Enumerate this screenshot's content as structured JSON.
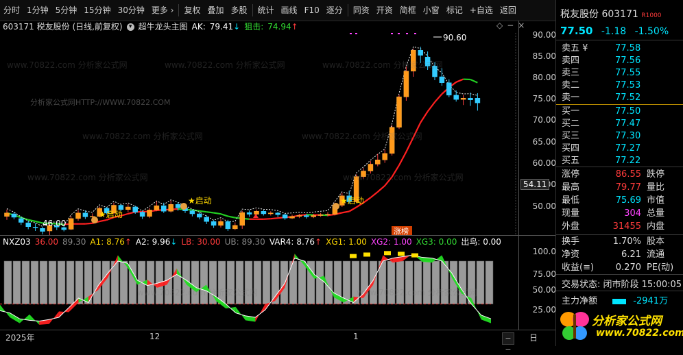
{
  "toolbar": {
    "items": [
      "分时",
      "1分钟",
      "5分钟",
      "15分钟",
      "30分钟",
      "更多 ›",
      "复权",
      "叠加",
      "多股",
      "统计",
      "画线",
      "F10",
      "逐分",
      "同资",
      "开资",
      "简框",
      "小窗",
      "标记",
      "+自选",
      "返回"
    ]
  },
  "main_header": {
    "code_name": "603171 税友股份 (日线,前复权)",
    "indicator": "超牛龙头主图",
    "ak_label": "AK:",
    "ak_value": "79.41",
    "ak_arrow": "↓",
    "snipe_label": "狙击:",
    "snipe_value": "74.94",
    "snipe_arrow": "↑"
  },
  "main_axis": {
    "labels": [
      "90.00",
      "85.00",
      "80.00",
      "75.00",
      "70.00",
      "65.00",
      "60.00",
      "55.00",
      "50.00"
    ],
    "crosshair_value": "54.11"
  },
  "annotations": {
    "high": "90.60",
    "low": "46.00",
    "start_label": "★启动",
    "limit_up": "涨榜"
  },
  "sub_header": {
    "name": "NXZ03",
    "v1": "36.00",
    "v2": "89.30",
    "a1_label": "A1:",
    "a1": "8.76",
    "a1_arrow": "↑",
    "a2_label": "A2:",
    "a2": "9.96",
    "a2_arrow": "↓",
    "lb_label": "LB:",
    "lb": "30.00",
    "ub_label": "UB:",
    "ub": "89.30",
    "var4_label": "VAR4:",
    "var4": "8.76",
    "var4_arrow": "↑",
    "xg1_label": "XG1:",
    "xg1": "1.00",
    "xg2_label": "XG2:",
    "xg2": "1.00",
    "xg3_label": "XG3:",
    "xg3": "0.00",
    "out_label": "出鸟:",
    "out": "0.00"
  },
  "sub_axis": {
    "labels": [
      "100.0",
      "75.00",
      "50.00",
      "25.00"
    ]
  },
  "time_axis": {
    "labels": [
      "2025年",
      "12",
      "1"
    ],
    "right_label": "日"
  },
  "watermark": {
    "text": "www.70822.com 分析家公式网",
    "center_text": "分析家公式网HTTP://WWW.70822.COM"
  },
  "quote": {
    "name": "税友股份",
    "code": "603171",
    "tag": "R1000",
    "price": "77.50",
    "change": "-1.18",
    "change_pct": "-1.50%",
    "asks": [
      {
        "label": "卖五 ¥",
        "price": "77.58"
      },
      {
        "label": "卖四",
        "price": "77.56"
      },
      {
        "label": "卖三",
        "price": "77.55"
      },
      {
        "label": "卖二",
        "price": "77.53"
      },
      {
        "label": "卖一",
        "price": "77.52"
      }
    ],
    "bids": [
      {
        "label": "买一",
        "price": "77.50"
      },
      {
        "label": "买二",
        "price": "77.47"
      },
      {
        "label": "买三",
        "price": "77.30"
      },
      {
        "label": "买四",
        "price": "77.27"
      },
      {
        "label": "买五",
        "price": "77.22"
      }
    ],
    "stats": [
      {
        "label": "涨停",
        "value": "86.55",
        "rlabel": "跌停"
      },
      {
        "label": "最高",
        "value": "79.77",
        "rlabel": "量比"
      },
      {
        "label": "最低",
        "value": "75.69",
        "rlabel": "市值"
      },
      {
        "label": "现量",
        "value": "304",
        "rlabel": "总量"
      },
      {
        "label": "外盘",
        "value": "31455",
        "rlabel": "内盘"
      }
    ],
    "stats2": [
      {
        "label": "换手",
        "value": "1.70%",
        "rlabel": "股本"
      },
      {
        "label": "净资",
        "value": "6.21",
        "rlabel": "流通"
      },
      {
        "label": "收益(≡)",
        "value": "0.270",
        "rlabel": "PE(动)"
      }
    ],
    "trade_status": "交易状态: 闭市阶段 15:00:05",
    "main_flow_label": "主力净额",
    "main_flow_value": "-2941万"
  },
  "logo": {
    "text": "分析家公式网",
    "url": "www.70822.com"
  },
  "chart_data": {
    "type": "candlestick",
    "y_range": [
      44,
      94
    ],
    "candles": [
      {
        "o": 51.0,
        "c": 51.8,
        "h": 52.6,
        "l": 50.2
      },
      {
        "o": 51.6,
        "c": 50.8,
        "h": 52.0,
        "l": 50.3
      },
      {
        "o": 50.5,
        "c": 49.6,
        "h": 51.0,
        "l": 49.0
      },
      {
        "o": 49.5,
        "c": 48.6,
        "h": 50.0,
        "l": 48.0
      },
      {
        "o": 48.5,
        "c": 48.4,
        "h": 49.4,
        "l": 47.6
      },
      {
        "o": 48.2,
        "c": 47.5,
        "h": 48.6,
        "l": 46.8
      },
      {
        "o": 47.6,
        "c": 48.9,
        "h": 49.3,
        "l": 46.0
      },
      {
        "o": 48.9,
        "c": 48.5,
        "h": 49.6,
        "l": 47.8
      },
      {
        "o": 48.4,
        "c": 47.9,
        "h": 48.7,
        "l": 47.5
      },
      {
        "o": 48.0,
        "c": 50.5,
        "h": 51.1,
        "l": 47.8
      },
      {
        "o": 50.5,
        "c": 51.8,
        "h": 52.5,
        "l": 50.0
      },
      {
        "o": 51.8,
        "c": 50.9,
        "h": 52.4,
        "l": 50.4
      },
      {
        "o": 50.9,
        "c": 51.0,
        "h": 51.7,
        "l": 50.2
      },
      {
        "o": 51.0,
        "c": 52.9,
        "h": 53.3,
        "l": 50.8
      },
      {
        "o": 52.9,
        "c": 51.8,
        "h": 53.2,
        "l": 51.5
      },
      {
        "o": 51.8,
        "c": 53.6,
        "h": 54.2,
        "l": 51.5
      },
      {
        "o": 53.6,
        "c": 52.6,
        "h": 53.8,
        "l": 52.2
      },
      {
        "o": 52.6,
        "c": 53.2,
        "h": 53.9,
        "l": 52.0
      },
      {
        "o": 53.2,
        "c": 52.0,
        "h": 53.5,
        "l": 51.6
      },
      {
        "o": 52.0,
        "c": 51.0,
        "h": 52.3,
        "l": 50.4
      },
      {
        "o": 51.0,
        "c": 52.5,
        "h": 53.0,
        "l": 50.6
      },
      {
        "o": 52.5,
        "c": 53.5,
        "h": 54.5,
        "l": 52.2
      },
      {
        "o": 53.5,
        "c": 52.2,
        "h": 54.2,
        "l": 51.8
      },
      {
        "o": 52.2,
        "c": 53.8,
        "h": 54.7,
        "l": 51.9
      },
      {
        "o": 53.8,
        "c": 53.0,
        "h": 54.3,
        "l": 52.3
      },
      {
        "o": 53.0,
        "c": 52.3,
        "h": 53.5,
        "l": 51.8
      },
      {
        "o": 52.3,
        "c": 51.6,
        "h": 52.6,
        "l": 51.0
      },
      {
        "o": 51.6,
        "c": 50.8,
        "h": 52.0,
        "l": 50.3
      },
      {
        "o": 50.8,
        "c": 49.8,
        "h": 51.2,
        "l": 49.2
      },
      {
        "o": 49.8,
        "c": 48.9,
        "h": 50.1,
        "l": 48.3
      },
      {
        "o": 48.9,
        "c": 49.8,
        "h": 50.4,
        "l": 48.4
      },
      {
        "o": 49.8,
        "c": 48.1,
        "h": 50.2,
        "l": 47.6
      },
      {
        "o": 48.1,
        "c": 48.9,
        "h": 49.6,
        "l": 47.8
      },
      {
        "o": 48.9,
        "c": 51.9,
        "h": 52.3,
        "l": 48.1
      },
      {
        "o": 51.9,
        "c": 51.5,
        "h": 52.4,
        "l": 50.9
      },
      {
        "o": 51.5,
        "c": 52.2,
        "h": 52.6,
        "l": 51.2
      },
      {
        "o": 52.2,
        "c": 51.6,
        "h": 52.5,
        "l": 51.2
      },
      {
        "o": 51.6,
        "c": 51.8,
        "h": 52.2,
        "l": 51.2
      },
      {
        "o": 51.8,
        "c": 51.4,
        "h": 52.1,
        "l": 50.8
      },
      {
        "o": 51.4,
        "c": 50.6,
        "h": 51.6,
        "l": 50.2
      },
      {
        "o": 50.6,
        "c": 51.0,
        "h": 51.4,
        "l": 50.4
      },
      {
        "o": 51.0,
        "c": 51.2,
        "h": 51.6,
        "l": 50.6
      },
      {
        "o": 51.2,
        "c": 50.9,
        "h": 51.5,
        "l": 50.5
      },
      {
        "o": 50.9,
        "c": 51.2,
        "h": 51.6,
        "l": 50.6
      },
      {
        "o": 51.2,
        "c": 51.4,
        "h": 51.8,
        "l": 50.9
      },
      {
        "o": 51.4,
        "c": 51.5,
        "h": 52.0,
        "l": 51.0
      },
      {
        "o": 51.5,
        "c": 53.6,
        "h": 54.2,
        "l": 51.2
      },
      {
        "o": 53.6,
        "c": 55.8,
        "h": 56.5,
        "l": 53.2
      },
      {
        "o": 55.8,
        "c": 54.4,
        "h": 57.0,
        "l": 54.0
      },
      {
        "o": 54.4,
        "c": 60.3,
        "h": 60.8,
        "l": 54.2
      },
      {
        "o": 60.3,
        "c": 61.6,
        "h": 62.3,
        "l": 59.8
      },
      {
        "o": 61.6,
        "c": 63.2,
        "h": 63.9,
        "l": 61.0
      },
      {
        "o": 63.2,
        "c": 64.2,
        "h": 65.6,
        "l": 62.7
      },
      {
        "o": 64.2,
        "c": 65.7,
        "h": 66.6,
        "l": 63.5
      },
      {
        "o": 65.7,
        "c": 71.8,
        "h": 72.3,
        "l": 65.2
      },
      {
        "o": 71.8,
        "c": 78.9,
        "h": 79.4,
        "l": 71.4
      },
      {
        "o": 78.9,
        "c": 84.9,
        "h": 86.0,
        "l": 78.0
      },
      {
        "o": 84.9,
        "c": 89.8,
        "h": 90.2,
        "l": 83.6
      },
      {
        "o": 89.8,
        "c": 88.6,
        "h": 90.6,
        "l": 86.8
      },
      {
        "o": 88.2,
        "c": 86.1,
        "h": 89.5,
        "l": 85.2
      },
      {
        "o": 86.1,
        "c": 83.6,
        "h": 87.0,
        "l": 82.8
      },
      {
        "o": 83.6,
        "c": 82.2,
        "h": 85.6,
        "l": 81.5
      },
      {
        "o": 82.2,
        "c": 79.3,
        "h": 83.0,
        "l": 78.8
      },
      {
        "o": 79.3,
        "c": 78.3,
        "h": 80.4,
        "l": 77.8
      },
      {
        "o": 78.3,
        "c": 78.6,
        "h": 79.4,
        "l": 77.0
      },
      {
        "o": 78.6,
        "c": 78.2,
        "h": 79.9,
        "l": 76.8
      },
      {
        "o": 78.6,
        "c": 77.5,
        "h": 79.77,
        "l": 75.69
      }
    ],
    "oscillator": [
      21,
      18,
      10,
      8,
      7,
      9,
      12,
      25,
      38,
      32,
      55,
      72,
      88,
      85,
      62,
      55,
      58,
      62,
      70,
      62,
      52,
      48,
      40,
      30,
      18,
      14,
      12,
      22,
      40,
      58,
      92,
      88,
      70,
      60,
      45,
      38,
      32,
      44,
      62,
      88,
      92,
      94,
      96,
      93,
      92,
      88,
      72,
      50,
      30,
      15,
      10
    ]
  }
}
